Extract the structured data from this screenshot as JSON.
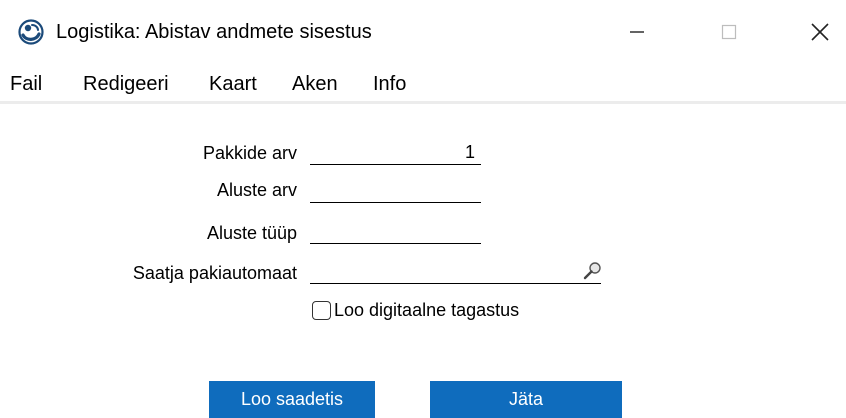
{
  "window": {
    "title": "Logistika: Abistav andmete sisestus",
    "icon": "app-logo-icon",
    "controls": {
      "minimize": "minimize-icon",
      "maximize": "maximize-icon",
      "close": "close-icon"
    }
  },
  "menu": {
    "items": [
      {
        "label": "Fail"
      },
      {
        "label": "Redigeeri"
      },
      {
        "label": "Kaart"
      },
      {
        "label": "Aken"
      },
      {
        "label": "Info"
      }
    ]
  },
  "form": {
    "fields": [
      {
        "label": "Pakkide arv",
        "value": "1"
      },
      {
        "label": "Aluste arv",
        "value": ""
      },
      {
        "label": "Aluste tüüp",
        "value": ""
      },
      {
        "label": "Saatja pakiautomaat",
        "value": "",
        "icon": "magnifier-icon"
      }
    ],
    "checkbox": {
      "label": "Loo digitaalne tagastus",
      "checked": false
    }
  },
  "buttons": {
    "create": "Loo saadetis",
    "cancel": "Jäta"
  },
  "colors": {
    "button_bg": "#0f6cbd",
    "button_text": "#ffffff",
    "menu_separator": "#ececec"
  }
}
